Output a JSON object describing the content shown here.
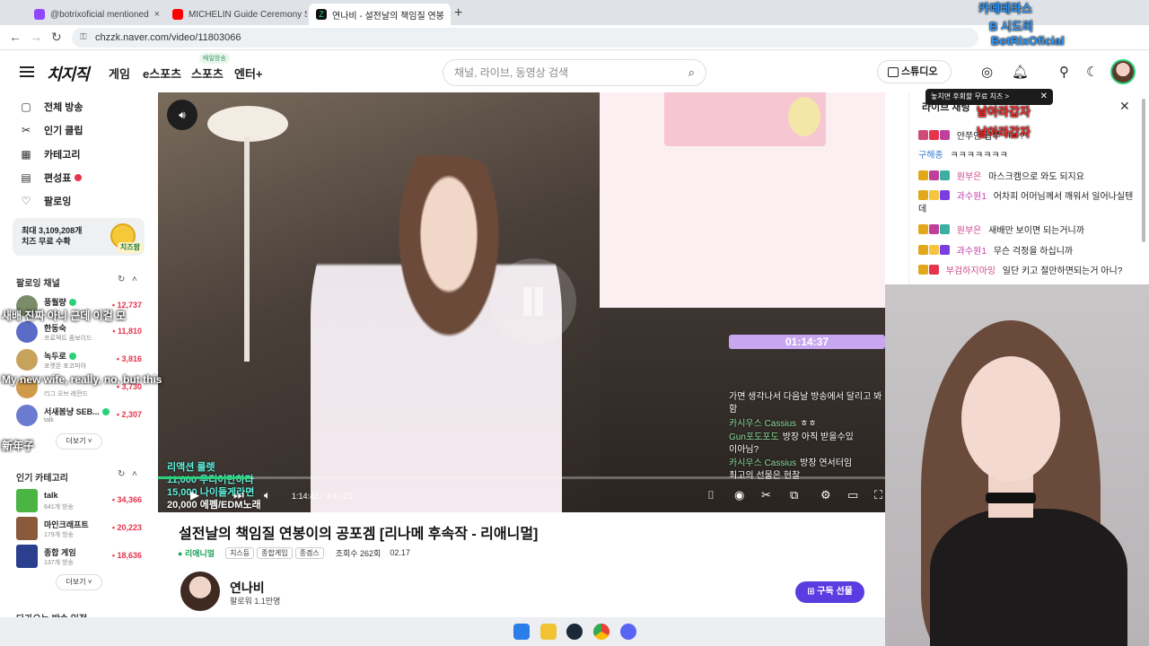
{
  "browser": {
    "tabs": [
      {
        "label": "@botrixoficial mentioned",
        "color": "#9146ff"
      },
      {
        "label": "MICHELIN Guide Ceremony Se",
        "color": "#ff0000"
      },
      {
        "label": "연나비 - 설전날의 책임질 연봉",
        "color": "#111111"
      }
    ],
    "url": "chzzk.naver.com/video/11803066"
  },
  "header": {
    "logo": "치지직",
    "nav": [
      "게임",
      "e스포츠",
      "스포츠",
      "엔터+"
    ],
    "sports_badge": "매일방송",
    "search_placeholder": "채널, 라이브, 동영상 검색",
    "studio_label": "스튜디오"
  },
  "sidebar": {
    "menu": [
      {
        "label": "전체 방송",
        "icon": "broadcast-icon"
      },
      {
        "label": "인기 클립",
        "icon": "scissors-icon"
      },
      {
        "label": "카테고리",
        "icon": "grid-icon"
      },
      {
        "label": "편성표",
        "icon": "calendar-icon"
      },
      {
        "label": "팔로잉",
        "icon": "heart-icon"
      }
    ],
    "cheese_banner": {
      "line1": "최대 3,109,208개",
      "line2": "치즈 무료 수확",
      "tag": "치즈팜"
    },
    "following_title": "팔로잉 채널",
    "channels": [
      {
        "name": "풍월량",
        "sub": "",
        "count": "12,737"
      },
      {
        "name": "한동숙",
        "sub": "프로젝트 좀보이드",
        "count": "11,810"
      },
      {
        "name": "녹두로",
        "sub": "포켓몬 포코피아",
        "count": "3,816"
      },
      {
        "name": "",
        "sub": "리그 오브 레전드",
        "count": "3,730"
      },
      {
        "name": "서새봄냥 SEB...",
        "sub": "talk",
        "count": "2,307"
      }
    ],
    "more_label": "더보기",
    "popular_title": "인기 카테고리",
    "categories": [
      {
        "name": "talk",
        "sub": "641개 방송",
        "count": "34,366"
      },
      {
        "name": "마인크래프트",
        "sub": "179개 방송",
        "count": "20,223"
      },
      {
        "name": "종합 게임",
        "sub": "137개 방송",
        "count": "18,636"
      }
    ],
    "more_label2": "더보기",
    "bottom_title": "다가오는 방송 일정"
  },
  "player": {
    "timer": "01:14:37",
    "time_current": "1:14:42",
    "time_total": "9:40:23",
    "progress": 0.129,
    "overlay_chat": [
      {
        "name": "",
        "text": "가면 생각나서 다음날 방송에서 달리고 봐"
      },
      {
        "name": "",
        "text": "함"
      },
      {
        "name": "카시우스 Cassius",
        "text": "ㅎㅎ"
      },
      {
        "name": "Gun포도포도",
        "text": "방장 아직 받을수있"
      },
      {
        "name": "",
        "text": "이아님?"
      },
      {
        "name": "카시우스 Cassius",
        "text": "방장 연서터임"
      },
      {
        "name": "",
        "text": "최고의 선물은 현찰"
      }
    ],
    "captions_cyan": [
      "리액션 룰렛",
      "11,000 우리어만하다",
      "15,000 나이들게라면"
    ],
    "caption_white": "20,000 에펨/EDM노래"
  },
  "video": {
    "title": "설전날의 책임질 연봉이의 공포겜 [리나메 후속작 - 리애니멀]",
    "category": "리애니멀",
    "tags": [
      "치스등",
      "종합게임",
      "종겜스"
    ],
    "views": "조회수 262회",
    "date": "02.17"
  },
  "channel": {
    "name": "연나비",
    "followers": "팔로워 1.1만명",
    "subscribe_label": "구독 선물"
  },
  "chat": {
    "title": "라이브 채팅",
    "popup": "놓치면 후회할 무료 치즈 >",
    "messages": [
      {
        "nick": "",
        "text": "얀쭈인 웜쭈 ㅋㅋ?",
        "nick_color": "#1aa35b"
      },
      {
        "nick": "구해종",
        "text": "ㅋㅋㅋㅋㅋㅋㅋ",
        "nick_color": "#3a7bd5"
      },
      {
        "nick": "원부은",
        "text": "마스크캠으로 와도 되지요",
        "nick_color": "#d0458b"
      },
      {
        "nick": "과수원1",
        "text": "어차피 어머님께서 깨워서 일어나실텐데",
        "nick_color": "#c23ea8"
      },
      {
        "nick": "원부은",
        "text": "새배만 보이면 되는거니까",
        "nick_color": "#d0458b"
      },
      {
        "nick": "과수원1",
        "text": "무슨 걱정을 하십니까",
        "nick_color": "#c23ea8"
      },
      {
        "nick": "부검하지마잉",
        "text": "일단 키고 절만하면되는거 아니?",
        "nick_color": "#d0458b"
      }
    ]
  },
  "overlay_names": [
    {
      "text": "카페테라스",
      "color": "#2f9bff"
    },
    {
      "text": "B 시드리",
      "color": "#2f9bff"
    },
    {
      "text": "BotRixOficial",
      "color": "#2f9bff"
    },
    {
      "text": "날아라갑자",
      "color": "#ff2b2b"
    },
    {
      "text": "날아라갑자",
      "color": "#ff2b2b"
    }
  ],
  "subtitles": [
    "새배 진짜 아니 근데 이걸 모",
    "My new wife, really, no, but this",
    "新年子"
  ]
}
